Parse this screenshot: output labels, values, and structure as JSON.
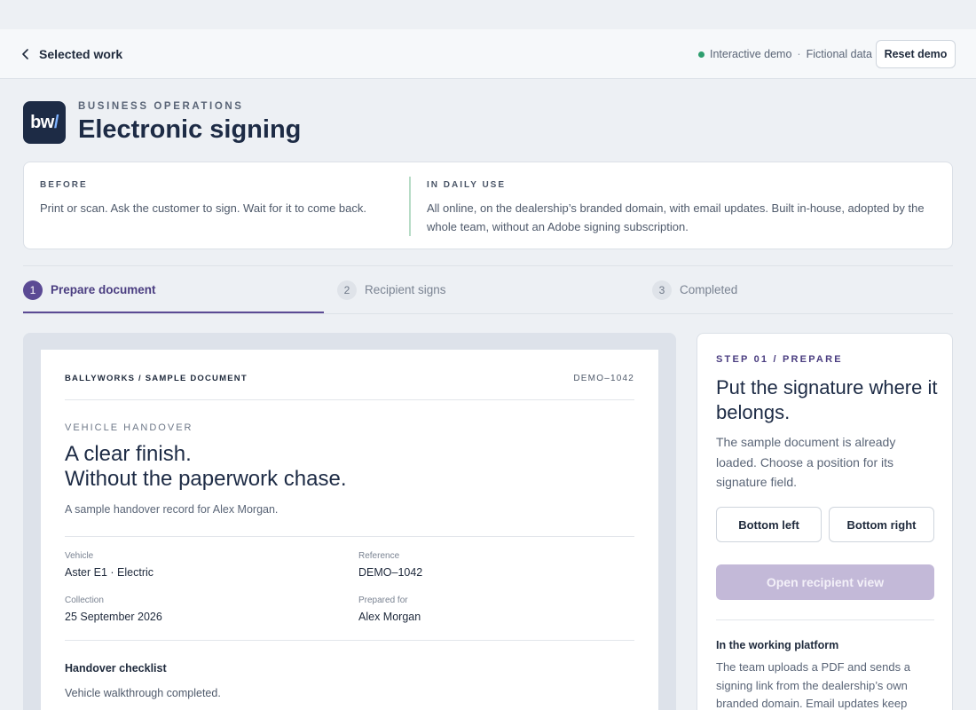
{
  "header": {
    "back_label": "Selected work",
    "demo_status": "Interactive demo",
    "separator": "·",
    "data_note": "Fictional data",
    "reset_label": "Reset demo"
  },
  "colors": {
    "accent": "#5b4a94",
    "status_dot": "#2e9e6e",
    "brand_dark": "#1d2b45"
  },
  "project": {
    "logo_main": "bw",
    "logo_slash": "/",
    "category": "BUSINESS OPERATIONS",
    "title": "Electronic signing"
  },
  "comparison": {
    "before_heading": "BEFORE",
    "before_text": "Print or scan. Ask the customer to sign. Wait for it to come back.",
    "after_heading": "IN DAILY USE",
    "after_text": "All online, on the dealership’s branded domain, with email updates. Built in-house, adopted by the whole team, without an Adobe signing subscription."
  },
  "steps": [
    {
      "num": "1",
      "label": "Prepare document",
      "active": true
    },
    {
      "num": "2",
      "label": "Recipient signs",
      "active": false
    },
    {
      "num": "3",
      "label": "Completed",
      "active": false
    }
  ],
  "document": {
    "brand": "BALLYWORKS / SAMPLE DOCUMENT",
    "doc_id": "DEMO–1042",
    "eyebrow": "VEHICLE HANDOVER",
    "headline_1": "A clear finish.",
    "headline_2": "Without the paperwork chase.",
    "subtitle": "A sample handover record for Alex Morgan.",
    "fields": {
      "vehicle_label": "Vehicle",
      "vehicle_value": "Aster E1 · Electric",
      "reference_label": "Reference",
      "reference_value": "DEMO–1042",
      "collection_label": "Collection",
      "collection_value": "25 September 2026",
      "prepared_label": "Prepared for",
      "prepared_value": "Alex Morgan"
    },
    "checklist_title": "Handover checklist",
    "checklist": [
      "Vehicle walkthrough completed."
    ]
  },
  "panel": {
    "eyebrow": "STEP 01 / PREPARE",
    "title": "Put the signature where it belongs.",
    "description": "The sample document is already loaded. Choose a position for its signature field.",
    "bottom_left": "Bottom left",
    "bottom_right": "Bottom right",
    "open_label": "Open recipient view",
    "platform_heading": "In the working platform",
    "platform_text": "The team uploads a PDF and sends a signing link from the dealership’s own branded domain. Email updates keep"
  }
}
